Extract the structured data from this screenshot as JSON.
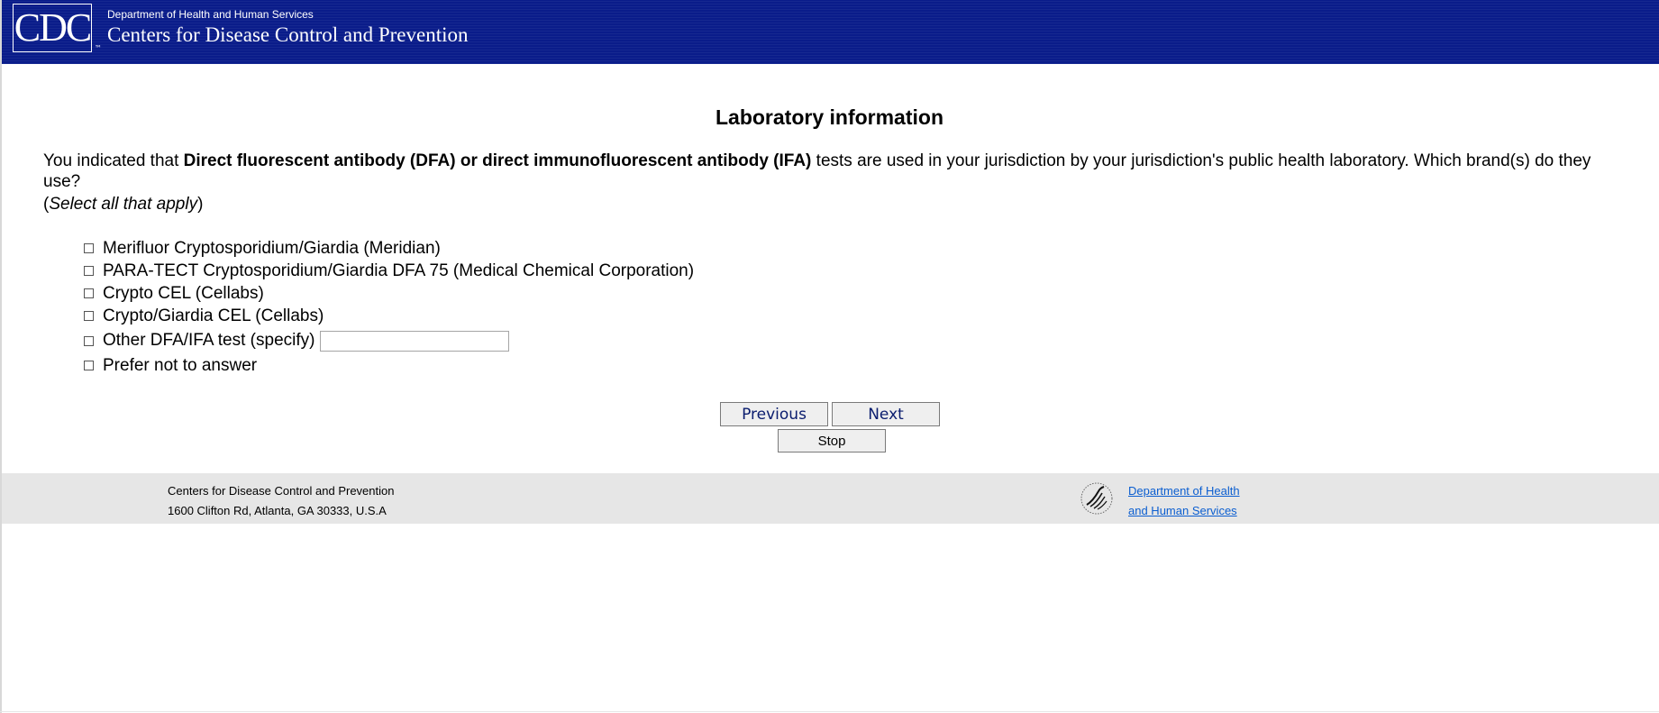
{
  "header": {
    "logo_text": "CDC",
    "logo_tm": "™",
    "department": "Department of Health and Human Services",
    "agency": "Centers for Disease Control and Prevention"
  },
  "page": {
    "title": "Laboratory information",
    "question_prefix": "You indicated that ",
    "question_emphasis": "Direct fluorescent antibody (DFA) or direct immunofluorescent antibody (IFA)",
    "question_suffix": " tests are used in your jurisdiction by your jurisdiction's public health laboratory. Which brand(s) do they use?",
    "instruction_open": "(",
    "instruction_text": "Select all that apply",
    "instruction_close": ")"
  },
  "options": [
    {
      "label": "Merifluor Cryptosporidium/Giardia (Meridian)"
    },
    {
      "label": "PARA-TECT Cryptosporidium/Giardia DFA 75 (Medical Chemical Corporation)"
    },
    {
      "label": "Crypto CEL (Cellabs)"
    },
    {
      "label": "Crypto/Giardia CEL (Cellabs)"
    },
    {
      "label": "Other DFA/IFA test (specify)",
      "input_value": ""
    },
    {
      "label": "Prefer not to answer"
    }
  ],
  "buttons": {
    "previous": "Previous",
    "next": "Next",
    "stop": "Stop"
  },
  "footer": {
    "org_name": "Centers for Disease Control and Prevention",
    "address": "1600 Clifton Rd, Atlanta, GA 30333, U.S.A",
    "hhs_link_line1": "Department of Health",
    "hhs_link_line2": "and Human Services"
  },
  "colors": {
    "header_bg": "#0a1c8a",
    "footer_bg": "#e6e6e6",
    "link": "#0b5ed0",
    "button_text": "#0a1c6e"
  },
  "icons": {
    "hhs_logo": "hhs-eagle-logo-icon"
  }
}
